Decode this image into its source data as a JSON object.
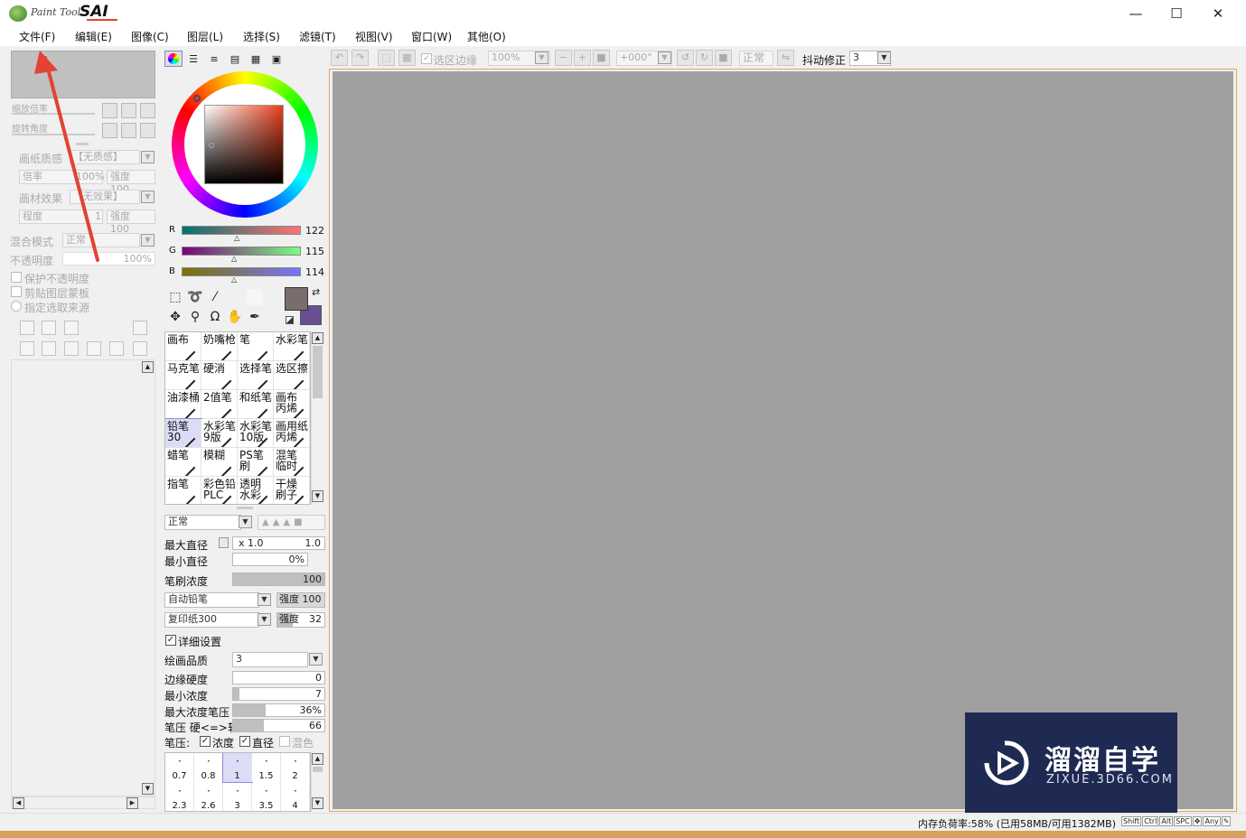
{
  "app": {
    "logo_small": "Paint Tool",
    "logo_big": "SAI"
  },
  "window_controls": {
    "minimize": "—",
    "maximize": "☐",
    "close": "✕"
  },
  "menu": [
    "文件(F)",
    "编辑(E)",
    "图像(C)",
    "图层(L)",
    "选择(S)",
    "滤镜(T)",
    "视图(V)",
    "窗口(W)",
    "其他(O)"
  ],
  "navigator": {
    "zoom_label": "缩放倍率",
    "rotate_label": "旋转角度"
  },
  "layer_props": {
    "paper_label": "画纸质感",
    "paper_value": "【无质感】",
    "scale_label": "倍率",
    "scale_value": "100%",
    "strength_label": "强度",
    "strength_value": "100",
    "effect_label": "画材效果",
    "effect_value": "【无效果】",
    "degree_label": "程度",
    "degree_value": "1",
    "strength2_label": "强度",
    "strength2_value": "100",
    "blend_label": "混合模式",
    "blend_value": "正常",
    "opacity_label": "不透明度",
    "opacity_value": "100%",
    "protect_opacity": "保护不透明度",
    "clip_mask": "剪贴图层蒙板",
    "selection_source": "指定选取来源"
  },
  "color": {
    "current_fg": "#7a6e6d",
    "current_bg": "#6a4e94",
    "r_label": "R",
    "r_value": "122",
    "g_label": "G",
    "g_value": "115",
    "b_label": "B",
    "b_value": "114"
  },
  "tools": [
    [
      "画布",
      "奶嘴枪",
      "笔",
      "水彩笔"
    ],
    [
      "马克笔",
      "硬消",
      "选择笔",
      "选区擦"
    ],
    [
      "油漆桶",
      "2值笔",
      "和纸笔",
      "画布 丙烯"
    ],
    [
      "铅笔30",
      "水彩笔 9版",
      "水彩笔 10版",
      "画用纸 丙烯"
    ],
    [
      "蜡笔",
      "模糊",
      "PS笔刷",
      "混笔 临时"
    ],
    [
      "指笔",
      "彩色铅 PLC",
      "透明 水彩",
      "干燥 刷子"
    ]
  ],
  "brush": {
    "blend_mode": "正常",
    "max_diameter_label": "最大直径",
    "max_diameter_mult": "x 1.0",
    "max_diameter_value": "1.0",
    "min_diameter_label": "最小直径",
    "min_diameter_value": "0%",
    "density_label": "笔刷浓度",
    "density_value": "100",
    "shape_value": "自动铅笔",
    "shape_strength_label": "强度",
    "shape_strength_value": "100",
    "texture_value": "复印纸300",
    "texture_strength_label": "强度",
    "texture_strength_value": "32",
    "detail_label": "详细设置",
    "quality_label": "绘画品质",
    "quality_value": "3",
    "edge_label": "边缘硬度",
    "edge_value": "0",
    "min_density_label": "最小浓度",
    "min_density_value": "7",
    "max_density_pressure_label": "最大浓度笔压",
    "max_density_pressure_value": "36%",
    "pressure_label": "笔压 硬<=>软",
    "pressure_value": "66",
    "pressure_row_label": "笔压:",
    "p_density": "浓度",
    "p_diameter": "直径",
    "p_blend": "混色",
    "sizes_row1": [
      "0.7",
      "0.8",
      "1",
      "1.5",
      "2"
    ],
    "sizes_row2": [
      "2.3",
      "2.6",
      "3",
      "3.5",
      "4"
    ]
  },
  "toolbar": {
    "sel_edge": "选区边缘",
    "zoom": "100%",
    "angle": "+000°",
    "mode": "正常",
    "stab_label": "抖动修正",
    "stab_value": "3"
  },
  "status": {
    "memory": "内存负荷率:58% (已用58MB/可用1382MB)",
    "keys": [
      "Shift",
      "Ctrl",
      "Alt",
      "SPC",
      "✥",
      "Any",
      "✎"
    ]
  },
  "watermark": {
    "title": "溜溜自学",
    "url": "ZIXUE.3D66.COM"
  },
  "colors": {
    "canvas": "#a0a0a0",
    "accent_red": "#e34234",
    "watermark_bg": "#1e2a52"
  }
}
